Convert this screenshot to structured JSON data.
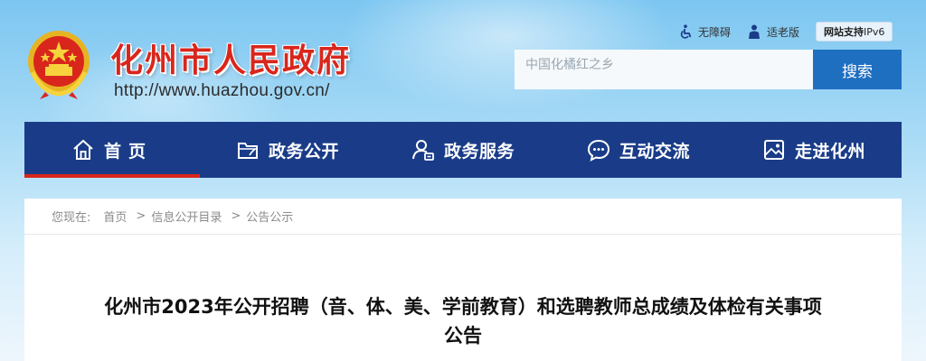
{
  "header": {
    "site_title": "化州市人民政府",
    "site_url": "http://www.huazhou.gov.cn/",
    "emblem_icon": "national-emblem-icon"
  },
  "top_links": {
    "accessibility": "无障碍",
    "elder_mode": "适老版",
    "ipv6_prefix": "网站支持",
    "ipv6_suffix": "IPv6"
  },
  "search": {
    "placeholder": "中国化橘红之乡",
    "button_label": "搜索"
  },
  "nav": {
    "items": [
      {
        "label": "首页",
        "icon": "home-icon"
      },
      {
        "label": "政务公开",
        "icon": "folder-icon"
      },
      {
        "label": "政务服务",
        "icon": "user-service-icon"
      },
      {
        "label": "互动交流",
        "icon": "chat-icon"
      },
      {
        "label": "走进化州",
        "icon": "picture-icon"
      }
    ]
  },
  "breadcrumb": {
    "prefix": "您现在:",
    "items": [
      "首页",
      "信息公开目录",
      "公告公示"
    ],
    "separator": ">"
  },
  "article": {
    "title_line1": "化州市2023年公开招聘（音、体、美、学前教育）和选聘教师总成绩及体检有关事项",
    "title_line2": "公告"
  },
  "colors": {
    "brand_red": "#d9261c",
    "nav_blue": "#1a3c88",
    "button_blue": "#1f6fc1"
  }
}
